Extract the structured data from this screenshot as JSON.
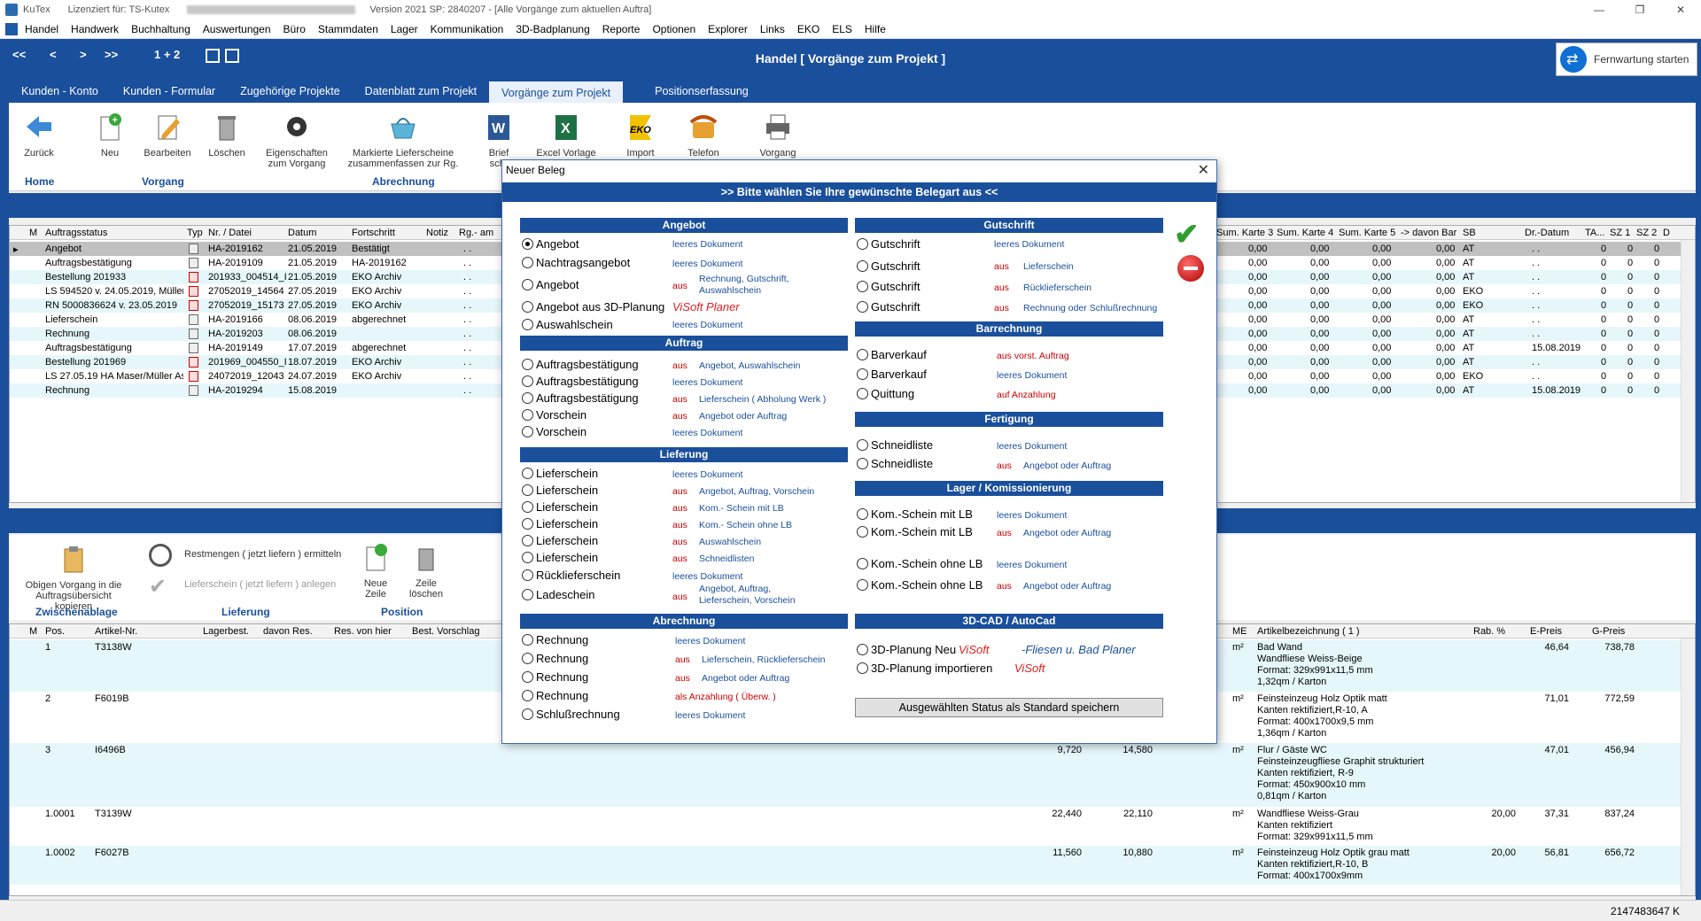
{
  "titlebar": {
    "app": "KuTex",
    "license": "Lizenziert für: TS-Kutex",
    "version": "Version 2021 SP: 2840207 - [Alle Vorgänge zum aktuellen Auftra]"
  },
  "menu": [
    "Handel",
    "Handwerk",
    "Buchhaltung",
    "Auswertungen",
    "Büro",
    "Stammdaten",
    "Lager",
    "Kommunikation",
    "3D-Badplanung",
    "Reporte",
    "Optionen",
    "Explorer",
    "Links",
    "EKO",
    "ELS",
    "Hilfe"
  ],
  "nav": {
    "first": "<<",
    "prev": "<",
    "next": ">",
    "last": ">>",
    "pages": "1 + 2",
    "title": "Handel  [ Vorgänge zum Projekt ]",
    "remote": "Fernwartung starten"
  },
  "tabs": [
    "Kunden - Konto",
    "Kunden - Formular",
    "Zugehörige Projekte",
    "Datenblatt zum Projekt",
    "Vorgänge zum Projekt",
    "Positionserfassung"
  ],
  "ribbon": {
    "zurueck": "Zurück",
    "neu": "Neu",
    "bearbeiten": "Bearbeiten",
    "loeschen": "Löschen",
    "eigenschaften": "Eigenschaften zum Vorgang",
    "markierte": "Markierte Lieferscheine zusammenfassen zur Rg.",
    "brief": "Brief schr",
    "excel": "Excel Vorlage",
    "import": "Import",
    "telefon": "Telefon",
    "vorgang": "Vorgang",
    "grp_home": "Home",
    "grp_vorgang": "Vorgang",
    "grp_abrechnung": "Abrechnung"
  },
  "grid1": {
    "headers": [
      "M",
      "Auftragsstatus",
      "Typ",
      "Nr. / Datei",
      "Datum",
      "Fortschritt",
      "Notiz",
      "Rg.- am"
    ],
    "right_headers": [
      "Sum. Karte 3",
      "Sum. Karte 4",
      "Sum. Karte 5",
      "-> davon Bar",
      "SB",
      "Dr.-Datum",
      "TA...",
      "SZ 1",
      "SZ 2",
      "D"
    ],
    "rows": [
      {
        "status": "Angebot",
        "nr": "HA-2019162",
        "datum": "21.05.2019",
        "fort": "Bestätigt",
        "rg": ". .",
        "k3": "0,00",
        "k4": "0,00",
        "k5": "0,00",
        "bar": "0,00",
        "sb": "AT",
        "dr": ". .",
        "ta": "0",
        "sz1": "0",
        "sz2": "0"
      },
      {
        "status": "Auftragsbestätigung",
        "nr": "HA-2019109",
        "datum": "21.05.2019",
        "fort": "HA-2019162",
        "rg": ". .",
        "k3": "0,00",
        "k4": "0,00",
        "k5": "0,00",
        "bar": "0,00",
        "sb": "AT",
        "dr": ". .",
        "ta": "0",
        "sz1": "0",
        "sz2": "0"
      },
      {
        "status": "Bestellung 201933",
        "nr": "201933_004514_I",
        "datum": "21.05.2019",
        "fort": "EKO Archiv",
        "rg": ". .",
        "k3": "0,00",
        "k4": "0,00",
        "k5": "0,00",
        "bar": "0,00",
        "sb": "AT",
        "dr": ". .",
        "ta": "0",
        "sz1": "0",
        "sz2": "0"
      },
      {
        "status": "LS 594520 v. 24.05.2019, Müller",
        "nr": "27052019_14564",
        "datum": "27.05.2019",
        "fort": "EKO Archiv",
        "rg": ". .",
        "k3": "0,00",
        "k4": "0,00",
        "k5": "0,00",
        "bar": "0,00",
        "sb": "EKO",
        "dr": ". .",
        "ta": "0",
        "sz1": "0",
        "sz2": "0"
      },
      {
        "status": "RN 5000836624 v. 23.05.2019",
        "nr": "27052019_15173",
        "datum": "27.05.2019",
        "fort": "EKO Archiv",
        "rg": ". .",
        "k3": "0,00",
        "k4": "0,00",
        "k5": "0,00",
        "bar": "0,00",
        "sb": "EKO",
        "dr": ". .",
        "ta": "0",
        "sz1": "0",
        "sz2": "0"
      },
      {
        "status": "Lieferschein",
        "nr": "HA-2019166",
        "datum": "08.06.2019",
        "fort": "abgerechnet",
        "rg": ". .",
        "k3": "0,00",
        "k4": "0,00",
        "k5": "0,00",
        "bar": "0,00",
        "sb": "AT",
        "dr": ". .",
        "ta": "0",
        "sz1": "0",
        "sz2": "0"
      },
      {
        "status": "Rechnung",
        "nr": "HA-2019203",
        "datum": "08.06.2019",
        "fort": "",
        "rg": ". .",
        "k3": "0,00",
        "k4": "0,00",
        "k5": "0,00",
        "bar": "0,00",
        "sb": "AT",
        "dr": ". .",
        "ta": "0",
        "sz1": "0",
        "sz2": "0"
      },
      {
        "status": "Auftragsbestätigung",
        "nr": "HA-2019149",
        "datum": "17.07.2019",
        "fort": "abgerechnet",
        "rg": ". .",
        "k3": "0,00",
        "k4": "0,00",
        "k5": "0,00",
        "bar": "0,00",
        "sb": "AT",
        "dr": "15.08.2019",
        "ta": "0",
        "sz1": "0",
        "sz2": "0"
      },
      {
        "status": "Bestellung 201969",
        "nr": "201969_004550_I",
        "datum": "18.07.2019",
        "fort": "EKO Archiv",
        "rg": ". .",
        "k3": "0,00",
        "k4": "0,00",
        "k5": "0,00",
        "bar": "0,00",
        "sb": "AT",
        "dr": ". .",
        "ta": "0",
        "sz1": "0",
        "sz2": "0"
      },
      {
        "status": "LS 27.05.19 HA Maser/Müller As",
        "nr": "24072019_12043",
        "datum": "24.07.2019",
        "fort": "EKO Archiv",
        "rg": ". .",
        "k3": "0,00",
        "k4": "0,00",
        "k5": "0,00",
        "bar": "0,00",
        "sb": "EKO",
        "dr": ". .",
        "ta": "0",
        "sz1": "0",
        "sz2": "0"
      },
      {
        "status": "Rechnung",
        "nr": "HA-2019294",
        "datum": "15.08.2019",
        "fort": "",
        "rg": ". .",
        "k3": "0,00",
        "k4": "0,00",
        "k5": "0,00",
        "bar": "0,00",
        "sb": "AT",
        "dr": "15.08.2019",
        "ta": "0",
        "sz1": "0",
        "sz2": "0"
      }
    ]
  },
  "ribbon2": {
    "obigen": "Obigen Vorgang in die Auftragsübersicht kopieren",
    "restmengen": "Restmengen ( jetzt liefern ) ermitteln",
    "lieferschein": "Lieferschein ( jetzt liefern ) anlegen",
    "neue_zeile": "Neue Zeile",
    "zeile_loeschen": "Zeile löschen",
    "grp_zwischen": "Zwischenablage",
    "grp_lieferung": "Lieferung",
    "grp_position": "Position"
  },
  "grid2": {
    "headers": [
      "M",
      "Pos.",
      "Artikel-Nr.",
      "Lagerbest.",
      "davon Res.",
      "Res. von hier",
      "Best. Vorschlag",
      "ME",
      "Artikelbezeichnung ( 1 )",
      "Rab. %",
      "E-Preis",
      "G-Preis"
    ],
    "rows": [
      {
        "pos": "1",
        "art": "T3138W",
        "me": "m²",
        "bez": [
          "Bad Wand",
          "Wandfliese Weiss-Beige",
          "Format: 329x991x11,5 mm",
          "1,32qm / Karton"
        ],
        "rab": "",
        "ep": "46,64",
        "gp": "738,78",
        "lb": "",
        "res": ""
      },
      {
        "pos": "2",
        "art": "F6019B",
        "me": "m²",
        "bez": [
          "Feinsteinzeug Holz Optik matt",
          "Kanten rektifiziert,R-10, A",
          "Format: 400x1700x9,5  mm",
          "1,36qm / Karton"
        ],
        "rab": "",
        "ep": "71,01",
        "gp": "772,59",
        "lb": "",
        "res": ""
      },
      {
        "pos": "3",
        "art": "I6496B",
        "me": "m²",
        "bez": [
          "Flur / Gäste WC",
          "Feinsteinzeugfliese Graphit strukturiert",
          "Kanten rektifiziert, R-9",
          "Format: 450x900x10 mm",
          "0,81qm / Karton"
        ],
        "rab": "",
        "ep": "47,01",
        "gp": "456,94",
        "lb": "9,720",
        "res": "14,580"
      },
      {
        "pos": "1.0001",
        "art": "T3139W",
        "me": "m²",
        "bez": [
          "Wandfliese Weiss-Grau",
          "Kanten rektifiziert",
          "Format: 329x991x11,5 mm"
        ],
        "rab": "20,00",
        "ep": "37,31",
        "gp": "837,24",
        "lb": "22,440",
        "res": "22,110"
      },
      {
        "pos": "1.0002",
        "art": "F6027B",
        "me": "m²",
        "bez": [
          "Feinsteinzeug Holz Optik grau matt",
          "Kanten rektifiziert,R-10, B",
          "Format: 400x1700x9mm"
        ],
        "rab": "20,00",
        "ep": "56,81",
        "gp": "656,72",
        "lb": "11,560",
        "res": "10,880"
      }
    ]
  },
  "status": "2147483647 K",
  "dialog": {
    "title": "Neuer Beleg",
    "header": ">> Bitte wählen Sie Ihre gewünschte Belegart aus <<",
    "aus": "aus",
    "sec_angebot": "Angebot",
    "sec_auftrag": "Auftrag",
    "sec_lieferung": "Lieferung",
    "sec_abrechnung": "Abrechnung",
    "sec_gutschrift": "Gutschrift",
    "sec_barrechnung": "Barrechnung",
    "sec_fertigung": "Fertigung",
    "sec_lager": "Lager / Komissionierung",
    "sec_cad": "3D-CAD / AutoCad",
    "angebot": "Angebot",
    "nachtragsangebot": "Nachtragsangebot",
    "angebot_3d": "Angebot aus 3D-Planung",
    "auswahlschein": "Auswahlschein",
    "leeres": "leeres Dokument",
    "rg_gs_aw": "Rechnung, Gutschrift, Auswahlschein",
    "visoft_planer": "ViSoft Planer",
    "auftragsbest": "Auftragsbestätigung",
    "vorschein": "Vorschein",
    "angebot_auswahl": "Angebot, Auswahlschein",
    "ls_abholung": "Lieferschein ( Abholung Werk )",
    "angebot_oder_auftrag": "Angebot oder Auftrag",
    "lieferschein": "Lieferschein",
    "ruecklieferschein": "Rücklieferschein",
    "ladeschein": "Ladeschein",
    "ang_auf_vor": "Angebot, Auftrag, Vorschein",
    "kom_mit": "Kom.- Schein mit LB",
    "kom_ohne": "Kom.- Schein ohne LB",
    "auswahlscheinen": "Auswahlschein",
    "schneidlisten": "Schneidlisten",
    "ang_auf_ls_vor": "Angebot, Auftrag, Lieferschein, Vorschein",
    "rechnung": "Rechnung",
    "schlussrechnung": "Schlußrechnung",
    "ls_rls": "Lieferschein, Rücklieferschein",
    "als_anzahlung": "als Anzahlung ( Überw. )",
    "gutschrift": "Gutschrift",
    "lieferschein_d": "Lieferschein",
    "ruecklieferschein_d": "Rücklieferschein",
    "rg_oder_schluss": "Rechnung oder Schlußrechnung",
    "barverkauf": "Barverkauf",
    "quittung": "Quittung",
    "aus_vorst_auftrag": "aus vorst. Auftrag",
    "auf_anzahlung": "auf Anzahlung",
    "schneidliste": "Schneidliste",
    "kom_schein_mit": "Kom.-Schein mit LB",
    "kom_schein_ohne": "Kom.-Schein ohne LB",
    "planung_neu": "3D-Planung Neu",
    "planung_import": "3D-Planung importieren",
    "visoft": "ViSoft",
    "fliesen_bad": "-Fliesen u. Bad Planer",
    "save_standard": "Ausgewählten Status als Standard speichern"
  },
  "colors": {
    "primary": "#1a4f9c",
    "selected_row": "#c0c0c0",
    "alt_row": "#e6f7fb",
    "aus": "#c00000"
  }
}
